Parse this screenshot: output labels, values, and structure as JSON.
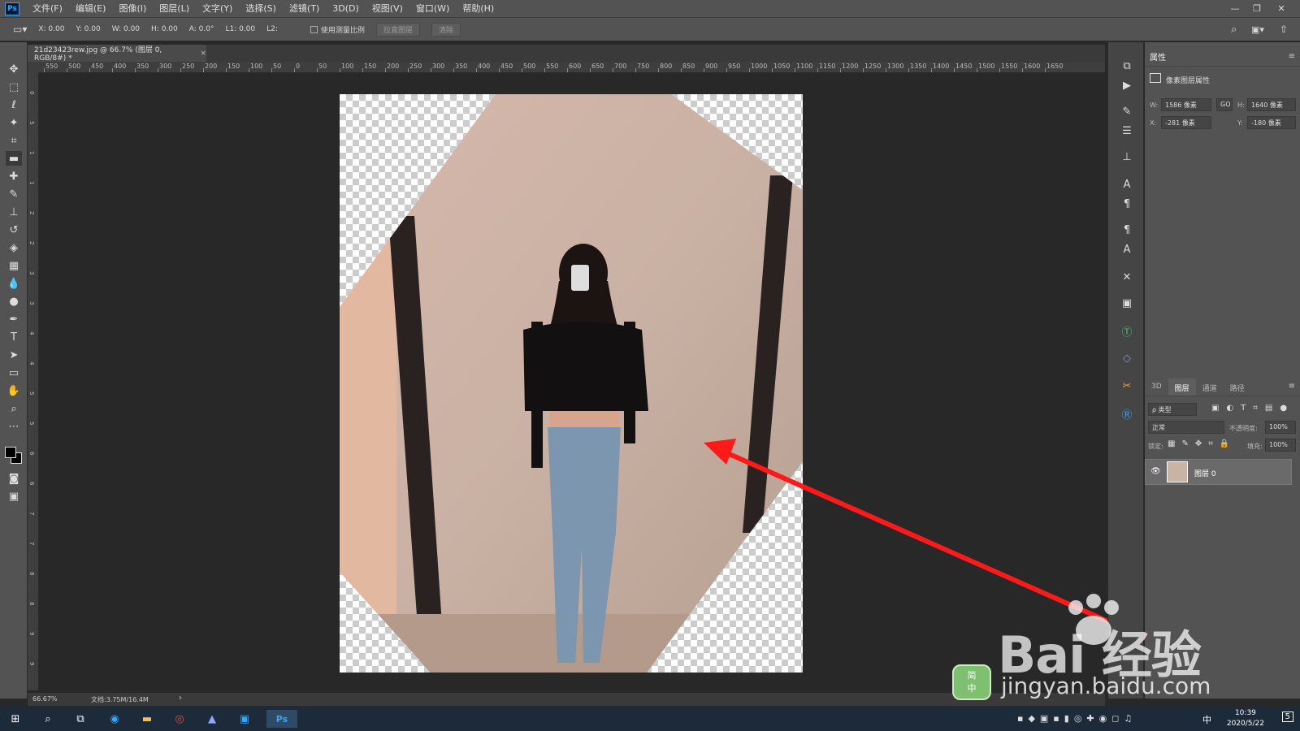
{
  "app": {
    "logo": "Ps"
  },
  "menu": [
    "文件(F)",
    "编辑(E)",
    "图像(I)",
    "图层(L)",
    "文字(Y)",
    "选择(S)",
    "滤镜(T)",
    "3D(D)",
    "视图(V)",
    "窗口(W)",
    "帮助(H)"
  ],
  "window_controls": {
    "minimize": "—",
    "restore": "❐",
    "close": "✕"
  },
  "options": {
    "x": "X: 0.00",
    "y": "Y: 0.00",
    "w": "W: 0.00",
    "h": "H: 0.00",
    "a": "A: 0.0°",
    "l1": "L1: 0.00",
    "l2": "L2:",
    "measure_scale": "使用测量比例",
    "straighten": "拉直图层",
    "clear": "清除"
  },
  "document": {
    "tab_title": "21d23423rew.jpg @ 66.7% (图层 0, RGB/8#) *",
    "close": "×"
  },
  "ruler": {
    "h_labels": [
      "550",
      "500",
      "450",
      "400",
      "350",
      "300",
      "250",
      "200",
      "150",
      "100",
      "50",
      "0",
      "50",
      "100",
      "150",
      "200",
      "250",
      "300",
      "350",
      "400",
      "450",
      "500",
      "550",
      "600",
      "650",
      "700",
      "750",
      "800",
      "850",
      "900",
      "950",
      "1000",
      "1050",
      "1100",
      "1150",
      "1200",
      "1250",
      "1300",
      "1350",
      "1400",
      "1450",
      "1500",
      "1550",
      "1600",
      "1650"
    ],
    "v_labels": [
      "0",
      "5",
      "1",
      "1",
      "2",
      "2",
      "3",
      "3",
      "4",
      "4",
      "5",
      "5",
      "6",
      "6",
      "7",
      "7",
      "8",
      "8",
      "9",
      "9"
    ]
  },
  "status": {
    "zoom": "66.67%",
    "doc_size": "文档:3.75M/16.4M",
    "more": "›"
  },
  "properties": {
    "title": "属性",
    "subtitle": "像素图层属性",
    "w_label": "W:",
    "w": "1586 像素",
    "h_label": "H:",
    "h": "1640 像素",
    "link": "GO",
    "x_label": "X:",
    "x": "-281 像素",
    "y_label": "Y:",
    "y": "-180 像素"
  },
  "layers": {
    "tabs": [
      "3D",
      "图层",
      "通道",
      "路径"
    ],
    "filter": "ρ 类型",
    "blend_mode": "正常",
    "opacity_label": "不透明度:",
    "opacity": "100%",
    "lock_label": "锁定:",
    "fill_label": "填充:",
    "fill": "100%",
    "layer_name": "图层 0"
  },
  "taskbar": {
    "time": "10:39",
    "date": "2020/5/22",
    "ime_lang": "中",
    "notifications": "5"
  },
  "watermark": {
    "brand": "Bai  经验",
    "url": "jingyan.baidu.com",
    "ime_top": "简",
    "ime_bottom": "中"
  },
  "colors": {
    "accent": "#31a8ff",
    "arrow": "#ff1a1a"
  }
}
